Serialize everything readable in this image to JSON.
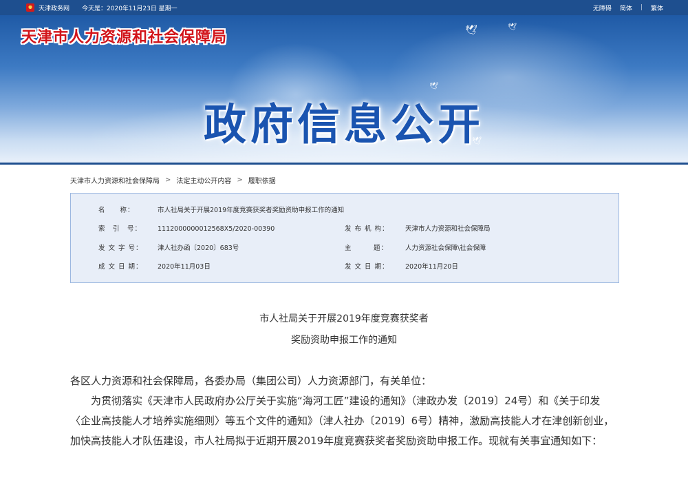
{
  "topbar": {
    "site_link": "天津政务网",
    "date_text": "今天是：2020年11月23日 星期一",
    "accessibility": "无障碍",
    "simplified": "简体",
    "traditional": "繁体",
    "separator": "|"
  },
  "banner": {
    "bureau_name": "天津市人力资源和社会保障局",
    "title": "政府信息公开"
  },
  "breadcrumb": {
    "items": [
      "天津市人力资源和社会保障局",
      "法定主动公开内容",
      "履职依据"
    ],
    "arrow": ">"
  },
  "meta": {
    "name_label": "名　　称：",
    "name_value": "市人社局关于开展2019年度竞赛获奖者奖励资助申报工作的通知",
    "index_label": "索　引　号：",
    "index_value": "1112000000012568X5/2020-00390",
    "publisher_label": "发 布 机 构：",
    "publisher_value": "天津市人力资源和社会保障局",
    "docno_label": "发 文 字 号：",
    "docno_value": "津人社办函〔2020〕683号",
    "subject_label": "主　　　题：",
    "subject_value": "人力资源社会保障\\社会保障",
    "created_label": "成 文 日 期：",
    "created_value": "2020年11月03日",
    "published_label": "发 文 日 期：",
    "published_value": "2020年11月20日"
  },
  "document": {
    "title_line1": "市人社局关于开展2019年度竞赛获奖者",
    "title_line2": "奖励资助申报工作的通知",
    "salutation": "各区人力资源和社会保障局，各委办局（集团公司）人力资源部门，有关单位：",
    "paragraph1": "为贯彻落实《天津市人民政府办公厅关于实施“海河工匠”建设的通知》（津政办发〔2019〕24号）和《关于印发〈企业高技能人才培养实施细则〉等五个文件的通知》（津人社办〔2019〕6号）精神，激励高技能人才在津创新创业，加快高技能人才队伍建设，市人社局拟于近期开展2019年度竞赛获奖者奖励资助申报工作。现就有关事宜通知如下："
  },
  "colors": {
    "topbar": "#1e4f8f",
    "bureau_red": "#d2141a",
    "title_blue": "#1a54b0",
    "meta_bg": "#e8eef8",
    "meta_border": "#9bb7e0"
  }
}
